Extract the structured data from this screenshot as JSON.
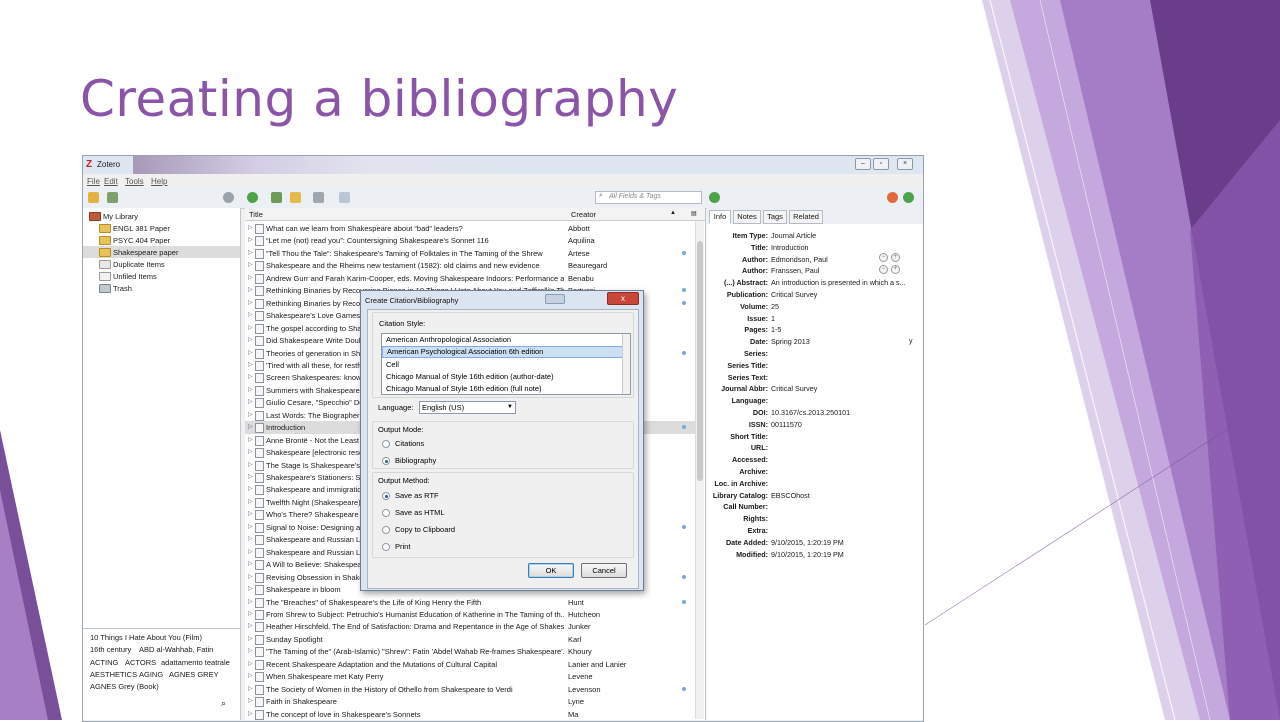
{
  "slide": {
    "title": "Creating a bibliography"
  },
  "colors": {
    "accent": "#8a54a8",
    "deco_dark": "#7a4f9a",
    "deco_light": "#b58fd0"
  },
  "window": {
    "title": "Zotero",
    "menu": [
      "File",
      "Edit",
      "Tools",
      "Help"
    ],
    "search_placeholder": "All Fields & Tags"
  },
  "library": {
    "items": [
      {
        "label": "My Library",
        "icon": "library-icon"
      },
      {
        "label": "ENGL 381 Paper",
        "icon": "folder-icon"
      },
      {
        "label": "PSYC 404 Paper",
        "icon": "folder-icon"
      },
      {
        "label": "Shakespeare paper",
        "icon": "folder-icon"
      },
      {
        "label": "Duplicate Items",
        "icon": "duplicate-icon"
      },
      {
        "label": "Unfiled Items",
        "icon": "unfiled-icon"
      },
      {
        "label": "Trash",
        "icon": "trash-icon"
      }
    ],
    "tags": [
      [
        "10 Things I Hate About You (Film)"
      ],
      [
        "16th century",
        "ABD al-Wahhab, Fatin"
      ],
      [
        "ACTING",
        "ACTORS",
        "adattamento teatrale"
      ],
      [
        "AESTHETICS",
        "AGING",
        "AGNES GREY"
      ],
      [
        "AGNES Grey (Book)"
      ]
    ]
  },
  "items": {
    "columns": {
      "title": "Title",
      "creator": "Creator"
    },
    "rows": [
      {
        "title": "What can we learn from Shakespeare about “bad” leaders?",
        "creator": "Abbott"
      },
      {
        "title": "“Let me (not) read you”: Countersigning Shakespeare's Sonnet 116",
        "creator": "Aquilina"
      },
      {
        "title": "“Tell Thou the Tale”: Shakespeare's Taming of Folktales in The Taming of the Shrew",
        "creator": "Artese"
      },
      {
        "title": "Shakespeare and the Rheims new testament (1582): old claims and new evidence",
        "creator": "Beauregard"
      },
      {
        "title": "Andrew Gurr and Farah Karim-Cooper, eds. Moving Shakespeare Indoors: Performance an...",
        "creator": "Benabu"
      },
      {
        "title": "Rethinking Binaries by Recovering Bianca in 10 Things I Hate About You and Zeffirelli's Th...",
        "creator": "Bertucci"
      },
      {
        "title": "Rethinking Binaries by Recovering Bianca in 10 Things I Hate About You and Zeffirelli's Th...",
        "creator": "Bertucci"
      },
      {
        "title": "Shakespeare's Love Games",
        "creator": ""
      },
      {
        "title": "The gospel according to Shakespeare",
        "creator": ""
      },
      {
        "title": "Did Shakespeare Write Double Falsehood?",
        "creator": ""
      },
      {
        "title": "Theories of generation in Shakespeare",
        "creator": ""
      },
      {
        "title": "'Tired with all these, for restful death I cry'",
        "creator": ""
      },
      {
        "title": "Screen Shakespeares: knowledge and adaptation",
        "creator": ""
      },
      {
        "title": "Summers with Shakespeare",
        "creator": ""
      },
      {
        "title": "Giulio Cesare, \"Specchio\" Del Presente",
        "creator": ""
      },
      {
        "title": "Last Words: The Biographer and the Poet",
        "creator": ""
      },
      {
        "title": "Introduction",
        "creator": "Edmondson"
      },
      {
        "title": "Anne Brontë - Not the Least",
        "creator": ""
      },
      {
        "title": "Shakespeare [electronic resource]",
        "creator": ""
      },
      {
        "title": "The Stage Is Shakespeare's",
        "creator": ""
      },
      {
        "title": "Shakespeare's Stationers: Studies in Cultural Bibliography",
        "creator": ""
      },
      {
        "title": "Shakespeare and immigration",
        "creator": ""
      },
      {
        "title": "Twelfth Night (Shakespeare)",
        "creator": ""
      },
      {
        "title": "Who's There? Shakespeare in Performance",
        "creator": ""
      },
      {
        "title": "Signal to Noise: Designing a Shakespeare Course",
        "creator": ""
      },
      {
        "title": "Shakespeare and Russian Literature",
        "creator": ""
      },
      {
        "title": "Shakespeare and Russian Literature",
        "creator": ""
      },
      {
        "title": "A Will to Believe: Shakespeare and Religion",
        "creator": ""
      },
      {
        "title": "Revising Obsession in Shakespeare's Sonnets",
        "creator": ""
      },
      {
        "title": "Shakespeare in bloom",
        "creator": ""
      },
      {
        "title": "The \"Breaches\" of Shakespeare's the Life of King Henry the Fifth",
        "creator": "Hunt"
      },
      {
        "title": "From Shrew to Subject: Petruchio's Humanist Education of Katherine in The Taming of th...",
        "creator": "Hutcheon"
      },
      {
        "title": "Heather Hirschfeld. The End of Satisfaction: Drama and Repentance in the Age of Shakesp...",
        "creator": "Junker"
      },
      {
        "title": "Sunday Spotlight",
        "creator": "Karl"
      },
      {
        "title": "\"The Taming of the\" (Arab-Islamic) \"Shrew\": Fatin 'Abdel Wahab Re-frames Shakespeare'...",
        "creator": "Khoury"
      },
      {
        "title": "Recent Shakespeare Adaptation and the Mutations of Cultural Capital",
        "creator": "Lanier and Lanier"
      },
      {
        "title": "When Shakespeare met Katy Perry",
        "creator": "Levene"
      },
      {
        "title": "The Society of Women in the History of Othello from Shakespeare to Verdi",
        "creator": "Levenson"
      },
      {
        "title": "Faith in Shakespeare",
        "creator": "Lyne"
      },
      {
        "title": "The concept of love in Shakespeare's Sonnets",
        "creator": "Ma"
      }
    ]
  },
  "info": {
    "tabs": [
      "Info",
      "Notes",
      "Tags",
      "Related"
    ],
    "fields": [
      {
        "label": "Item Type:",
        "value": "Journal Article"
      },
      {
        "label": "Title:",
        "value": "Introduction"
      },
      {
        "label": "Author:",
        "value": "Edmondson, Paul"
      },
      {
        "label": "Author:",
        "value": "Franssen, Paul"
      },
      {
        "label": "(...) Abstract:",
        "value": "An introduction is presented in which a s..."
      },
      {
        "label": "Publication:",
        "value": "Critical Survey"
      },
      {
        "label": "Volume:",
        "value": "25"
      },
      {
        "label": "Issue:",
        "value": "1"
      },
      {
        "label": "Pages:",
        "value": "1-5"
      },
      {
        "label": "Date:",
        "value": "Spring 2013"
      },
      {
        "label": "Series:",
        "value": ""
      },
      {
        "label": "Series Title:",
        "value": ""
      },
      {
        "label": "Series Text:",
        "value": ""
      },
      {
        "label": "Journal Abbr:",
        "value": "Critical Survey"
      },
      {
        "label": "Language:",
        "value": ""
      },
      {
        "label": "DOI:",
        "value": "10.3167/cs.2013.250101"
      },
      {
        "label": "ISSN:",
        "value": "00111570"
      },
      {
        "label": "Short Title:",
        "value": ""
      },
      {
        "label": "URL:",
        "value": ""
      },
      {
        "label": "Accessed:",
        "value": ""
      },
      {
        "label": "Archive:",
        "value": ""
      },
      {
        "label": "Loc. in Archive:",
        "value": ""
      },
      {
        "label": "Library Catalog:",
        "value": "EBSCOhost"
      },
      {
        "label": "Call Number:",
        "value": ""
      },
      {
        "label": "Rights:",
        "value": ""
      },
      {
        "label": "Extra:",
        "value": ""
      },
      {
        "label": "Date Added:",
        "value": "9/10/2015, 1:20:19 PM"
      },
      {
        "label": "Modified:",
        "value": "9/10/2015, 1:20:19 PM"
      }
    ],
    "date_flag": "y"
  },
  "dialog": {
    "title": "Create Citation/Bibliography",
    "close": "x",
    "citation_style_label": "Citation Style:",
    "styles": [
      "American Anthropological Association",
      "American Psychological Association 6th edition",
      "Cell",
      "Chicago Manual of Style 16th edition (author-date)",
      "Chicago Manual of Style 16th edition (full note)"
    ],
    "selected_style": "American Psychological Association 6th edition",
    "language_label": "Language:",
    "language_value": "English (US)",
    "output_mode_label": "Output Mode:",
    "output_modes": [
      "Citations",
      "Bibliography"
    ],
    "selected_mode": "Bibliography",
    "output_method_label": "Output Method:",
    "output_methods": [
      "Save as RTF",
      "Save as HTML",
      "Copy to Clipboard",
      "Print"
    ],
    "selected_method": "Save as RTF",
    "ok": "OK",
    "cancel": "Cancel"
  }
}
